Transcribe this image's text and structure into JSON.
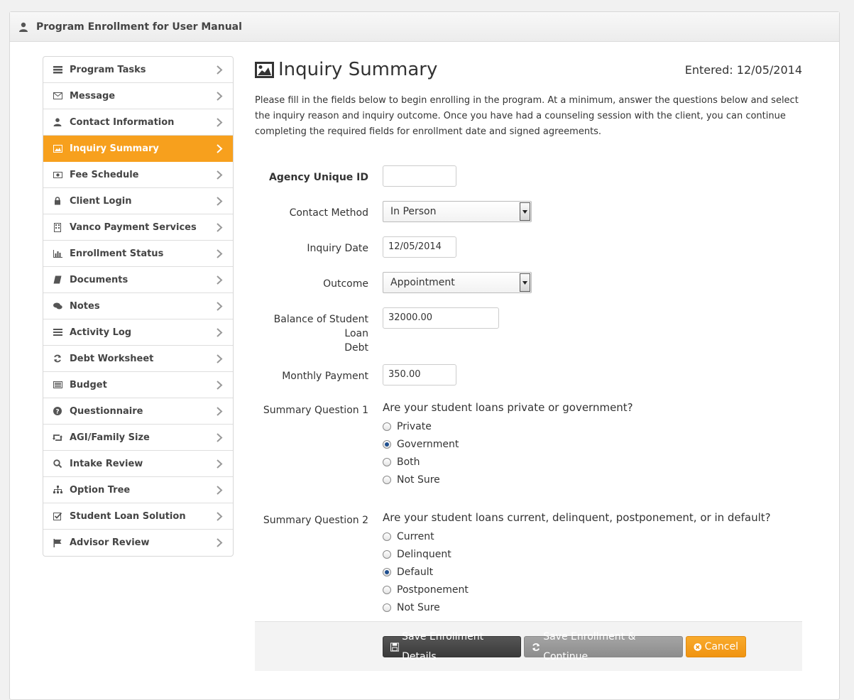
{
  "header": {
    "title": "Program Enrollment for User Manual"
  },
  "sidebar": {
    "items": [
      {
        "label": "Program Tasks",
        "icon": "tasks-icon"
      },
      {
        "label": "Message",
        "icon": "envelope-icon"
      },
      {
        "label": "Contact Information",
        "icon": "user-icon"
      },
      {
        "label": "Inquiry Summary",
        "icon": "picture-icon",
        "active": true
      },
      {
        "label": "Fee Schedule",
        "icon": "money-icon"
      },
      {
        "label": "Client Login",
        "icon": "lock-icon"
      },
      {
        "label": "Vanco Payment Services",
        "icon": "building-icon"
      },
      {
        "label": "Enrollment Status",
        "icon": "bar-chart-icon"
      },
      {
        "label": "Documents",
        "icon": "book-icon"
      },
      {
        "label": "Notes",
        "icon": "comments-icon"
      },
      {
        "label": "Activity Log",
        "icon": "list-icon"
      },
      {
        "label": "Debt Worksheet",
        "icon": "refresh-icon"
      },
      {
        "label": "Budget",
        "icon": "calculator-icon"
      },
      {
        "label": "Questionnaire",
        "icon": "question-icon"
      },
      {
        "label": "AGI/Family Size",
        "icon": "retweet-icon"
      },
      {
        "label": "Intake Review",
        "icon": "search-icon"
      },
      {
        "label": "Option Tree",
        "icon": "sitemap-icon"
      },
      {
        "label": "Student Loan Solution",
        "icon": "check-square-icon"
      },
      {
        "label": "Advisor Review",
        "icon": "flag-icon"
      }
    ]
  },
  "main": {
    "title": "Inquiry Summary",
    "entered": "Entered: 12/05/2014",
    "intro": "Please fill in the fields below to begin enrolling in the program. At a minimum, answer the questions below and select the inquiry reason and inquiry outcome. Once you have had a counseling session with the client, you can continue completing the required fields for enrollment date and signed agreements."
  },
  "form": {
    "agency_id": {
      "label": "Agency Unique ID",
      "value": ""
    },
    "contact_method": {
      "label": "Contact Method",
      "value": "In Person"
    },
    "inquiry_date": {
      "label": "Inquiry Date",
      "value": "12/05/2014"
    },
    "outcome": {
      "label": "Outcome",
      "value": "Appointment"
    },
    "balance": {
      "label_line1": "Balance of Student Loan",
      "label_line2": "Debt",
      "value": "32000.00"
    },
    "monthly_payment": {
      "label": "Monthly Payment",
      "value": "350.00"
    },
    "q1": {
      "label": "Summary Question 1",
      "question": "Are your student loans private or government?",
      "options": [
        "Private",
        "Government",
        "Both",
        "Not Sure"
      ],
      "selected": "Government"
    },
    "q2": {
      "label": "Summary Question 2",
      "question": "Are your student loans current, delinquent, postponement, or in default?",
      "options": [
        "Current",
        "Delinquent",
        "Default",
        "Postponement",
        "Not Sure"
      ],
      "selected": "Default"
    }
  },
  "footer": {
    "save_label": "Save Enrollment Details",
    "save_continue_label": "Save Enrollment & Continue",
    "cancel_label": "Cancel"
  },
  "colors": {
    "accent": "#f7a01d",
    "dark_button": "#444444",
    "grey_button": "#999999"
  }
}
